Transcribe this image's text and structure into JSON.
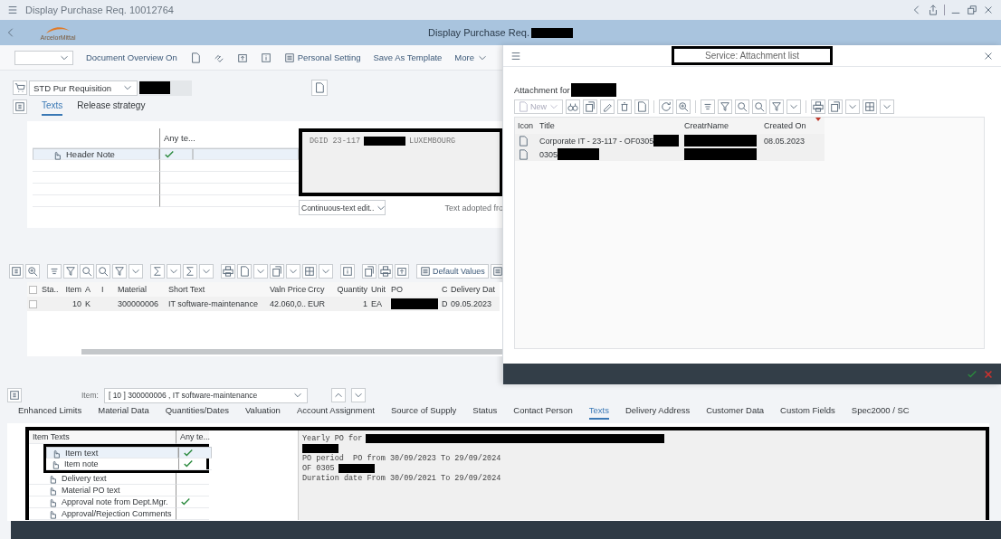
{
  "window": {
    "title": "Display Purchase Req. 10012764"
  },
  "app_bar": {
    "logo_text": "ArcelorMittal",
    "title": "Display Purchase Req."
  },
  "toolbar": {
    "buttons": [
      {
        "kind": "text",
        "label": "Document Overview On"
      },
      {
        "kind": "icon"
      },
      {
        "kind": "icon"
      },
      {
        "kind": "icon"
      },
      {
        "kind": "icon"
      },
      {
        "kind": "icon_text",
        "label": "Personal Setting"
      },
      {
        "kind": "text",
        "label": "Save As Template"
      },
      {
        "kind": "menu",
        "label": "More"
      }
    ]
  },
  "document_type": "STD Pur Requisition",
  "header_tabs": [
    {
      "label": "Texts",
      "selected": true
    },
    {
      "label": "Release strategy",
      "selected": false
    }
  ],
  "header_texts": {
    "column": "Any te...",
    "rows": [
      {
        "name": "Header Note",
        "filled": true,
        "selected": true
      }
    ],
    "editor_lines": [
      [
        {
          "kind": "text",
          "text": "DGID 23-117"
        },
        {
          "kind": "redacted"
        },
        {
          "kind": "text",
          "text": "LUXEMBOURG"
        }
      ]
    ],
    "editor_mode": "Continuous-text edit..",
    "note": "Text adopted fro",
    "framed": true
  },
  "item_toolbar": {
    "default_button": "Default Values"
  },
  "items_table": {
    "all_selected": false,
    "columns": [
      "Sta..",
      "Item",
      "A",
      "I",
      "Material",
      "Short Text",
      "Valn Price",
      "Crcy",
      "Quantity",
      "Unit",
      "PO",
      "C",
      "Delivery Dat"
    ],
    "rows": [
      {
        "selected": false,
        "cells": [
          {
            "kind": "empty"
          },
          {
            "kind": "text",
            "text": "10"
          },
          {
            "kind": "text",
            "text": "K"
          },
          {
            "kind": "empty"
          },
          {
            "kind": "text",
            "text": "300000006"
          },
          {
            "kind": "text",
            "text": "IT software-maintenance"
          },
          {
            "kind": "text",
            "text": "42.060,0.."
          },
          {
            "kind": "text",
            "text": "EUR"
          },
          {
            "kind": "text",
            "text": "1"
          },
          {
            "kind": "text",
            "text": "EA"
          },
          {
            "kind": "redacted"
          },
          {
            "kind": "text",
            "text": "D"
          },
          {
            "kind": "text",
            "text": "09.05.2023"
          }
        ]
      }
    ]
  },
  "item_selector": {
    "label": "Item:",
    "value": "[ 10 ] 300000006 , IT software-maintenance"
  },
  "item_tabs": [
    {
      "label": "Enhanced Limits",
      "selected": false
    },
    {
      "label": "Material Data",
      "selected": false
    },
    {
      "label": "Quantities/Dates",
      "selected": false
    },
    {
      "label": "Valuation",
      "selected": false
    },
    {
      "label": "Account Assignment",
      "selected": false
    },
    {
      "label": "Source of Supply",
      "selected": false
    },
    {
      "label": "Status",
      "selected": false
    },
    {
      "label": "Contact Person",
      "selected": false
    },
    {
      "label": "Texts",
      "selected": true
    },
    {
      "label": "Delivery Address",
      "selected": false
    },
    {
      "label": "Customer Data",
      "selected": false
    },
    {
      "label": "Custom Fields",
      "selected": false
    },
    {
      "label": "Spec2000 / SC",
      "selected": false
    }
  ],
  "item_texts": {
    "columns": [
      "Item Texts",
      "Any te..."
    ],
    "framed": true,
    "rows": [
      {
        "name": "Item text",
        "filled": true,
        "framed": true,
        "selected": true
      },
      {
        "name": "Item note",
        "filled": true,
        "framed": true,
        "selected": false
      },
      {
        "name": "Delivery text",
        "filled": false,
        "framed": false,
        "selected": false
      },
      {
        "name": "Material PO text",
        "filled": false,
        "framed": false,
        "selected": false
      },
      {
        "name": "Approval note from Dept.Mgr.",
        "filled": true,
        "framed": false,
        "selected": false
      },
      {
        "name": "Approval/Rejection Comments",
        "filled": false,
        "framed": false,
        "selected": false
      }
    ],
    "editor_lines": [
      [
        {
          "kind": "text",
          "text": "Yearly PO for"
        },
        {
          "kind": "redacted_long"
        }
      ],
      [
        {
          "kind": "redacted"
        }
      ],
      [
        {
          "kind": "text",
          "text": "PO period  PO from 30/09/2023 To 29/09/2024"
        }
      ],
      [
        {
          "kind": "text",
          "text": "OF 0305"
        },
        {
          "kind": "redacted"
        }
      ],
      [
        {
          "kind": "text",
          "text": "Duration date From 30/09/2021 To 29/09/2024"
        }
      ]
    ]
  },
  "dialog": {
    "title": "Service: Attachment list",
    "title_framed": true,
    "attachment_label": "Attachment for",
    "new_button": {
      "label": "New",
      "disabled": true
    },
    "columns": [
      {
        "label": "Icon",
        "sorted": false
      },
      {
        "label": "Title",
        "sorted": false
      },
      {
        "label": "CreatrName",
        "sorted": false
      },
      {
        "label": "Created On",
        "sorted": true
      }
    ],
    "rows": [
      {
        "title": [
          {
            "kind": "text",
            "text": "Corporate IT - 23-117 - OF0305"
          },
          {
            "kind": "redacted"
          }
        ],
        "creator": [
          {
            "kind": "redacted_long"
          }
        ],
        "created_on": "08.05.2023"
      },
      {
        "title": [
          {
            "kind": "text",
            "text": "0305"
          },
          {
            "kind": "redacted"
          }
        ],
        "creator": [
          {
            "kind": "redacted_long"
          }
        ]
      }
    ]
  }
}
